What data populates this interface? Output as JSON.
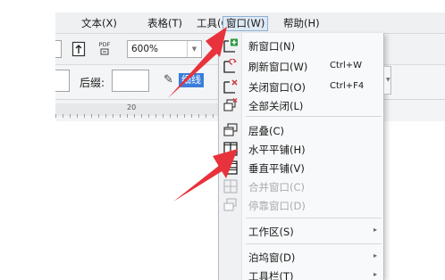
{
  "menubar": {
    "items": [
      {
        "label": "文本(X)"
      },
      {
        "label": "表格(T)"
      },
      {
        "label": "工具(O)"
      },
      {
        "label": "窗口(W)"
      },
      {
        "label": "帮助(H)"
      }
    ]
  },
  "toolbar": {
    "pdf_label": "PDF",
    "zoom_value": "600%",
    "suffix_label": "后缀:",
    "line_type_label": "细线"
  },
  "ruler": {
    "tick_label": "20"
  },
  "window_menu": {
    "items": [
      {
        "label": "新窗口(N)",
        "shortcut": "",
        "icon": "new-window-icon",
        "enabled": true,
        "submenu": false
      },
      {
        "label": "刷新窗口(W)",
        "shortcut": "Ctrl+W",
        "icon": "refresh-window-icon",
        "enabled": true,
        "submenu": false
      },
      {
        "label": "关闭窗口(O)",
        "shortcut": "Ctrl+F4",
        "icon": "close-window-icon",
        "enabled": true,
        "submenu": false
      },
      {
        "label": "全部关闭(L)",
        "shortcut": "",
        "icon": "close-all-icon",
        "enabled": true,
        "submenu": false
      },
      {
        "label": "层叠(C)",
        "shortcut": "",
        "icon": "cascade-icon",
        "enabled": true,
        "submenu": false
      },
      {
        "label": "水平平铺(H)",
        "shortcut": "",
        "icon": "tile-horizontal-icon",
        "enabled": true,
        "submenu": false
      },
      {
        "label": "垂直平铺(V)",
        "shortcut": "",
        "icon": "tile-vertical-icon",
        "enabled": true,
        "submenu": false
      },
      {
        "label": "合并窗口(C)",
        "shortcut": "",
        "icon": "merge-window-icon",
        "enabled": false,
        "submenu": false
      },
      {
        "label": "停靠窗口(D)",
        "shortcut": "",
        "icon": "dock-window-icon",
        "enabled": false,
        "submenu": false
      },
      {
        "label": "工作区(S)",
        "shortcut": "",
        "icon": "",
        "enabled": true,
        "submenu": true
      },
      {
        "label": "泊坞窗(D)",
        "shortcut": "",
        "icon": "",
        "enabled": true,
        "submenu": true
      },
      {
        "label": "工具栏(T)",
        "shortcut": "",
        "icon": "",
        "enabled": true,
        "submenu": true
      }
    ],
    "submenu_glyph": "▸"
  },
  "colors": {
    "annotation_arrow": "#e8323c",
    "selection_blue": "#3b7ddd",
    "menu_active_bg": "#dde9f5"
  }
}
